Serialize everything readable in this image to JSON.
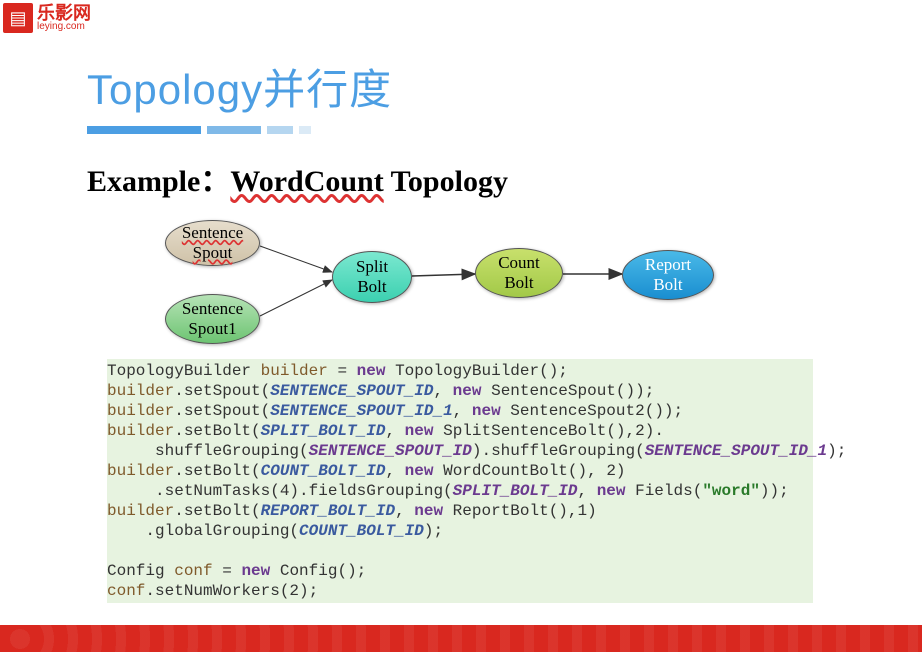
{
  "logo": {
    "cn": "乐影网",
    "en": "leying.com"
  },
  "title": "Topology并行度",
  "example_label": "Example：",
  "wordcount": "WordCount",
  "example_suffix": " Topology",
  "nodes": {
    "ss_l1": "Sentence",
    "ss_l2": "Spout",
    "ss1_l1": "Sentence",
    "ss1_l2": "Spout1",
    "split_l1": "Split",
    "split_l2": "Bolt",
    "count_l1": "Count",
    "count_l2": "Bolt",
    "report_l1": "Report",
    "report_l2": "Bolt"
  },
  "code": {
    "l1a": "TopologyBuilder ",
    "l1b": "builder",
    "l1c": " = ",
    "l1d": "new",
    "l1e": " TopologyBuilder();",
    "l2a": "builder",
    "l2b": ".setSpout(",
    "l2c": "SENTENCE_SPOUT_ID",
    "l2d": ", ",
    "l2e": "new",
    "l2f": " SentenceSpout());",
    "l3a": "builder",
    "l3b": ".setSpout(",
    "l3c": "SENTENCE_SPOUT_ID_1",
    "l3d": ", ",
    "l3e": "new",
    "l3f": " SentenceSpout2());",
    "l4a": "builder",
    "l4b": ".setBolt(",
    "l4c": "SPLIT_BOLT_ID",
    "l4d": ", ",
    "l4e": "new",
    "l4f": " SplitSentenceBolt(),2).",
    "l5a": "     shuffleGrouping(",
    "l5b": "SENTENCE_SPOUT_ID",
    "l5c": ").shuffleGrouping(",
    "l5d": "SENTENCE_SPOUT_ID_1",
    "l5e": ");",
    "l6a": "builder",
    "l6b": ".setBolt(",
    "l6c": "COUNT_BOLT_ID",
    "l6d": ", ",
    "l6e": "new",
    "l6f": " WordCountBolt(), 2)",
    "l7a": "     .setNumTasks(4).fieldsGrouping(",
    "l7b": "SPLIT_BOLT_ID",
    "l7c": ", ",
    "l7d": "new",
    "l7e": " Fields(",
    "l7f": "\"word\"",
    "l7g": "));",
    "l8a": "builder",
    "l8b": ".setBolt(",
    "l8c": "REPORT_BOLT_ID",
    "l8d": ", ",
    "l8e": "new",
    "l8f": " ReportBolt(),1)",
    "l9a": "    .globalGrouping(",
    "l9b": "COUNT_BOLT_ID",
    "l9c": ");",
    "l11a": "Config ",
    "l11b": "conf",
    "l11c": " = ",
    "l11d": "new",
    "l11e": " Config();",
    "l12a": "conf",
    "l12b": ".setNumWorkers(2);"
  }
}
